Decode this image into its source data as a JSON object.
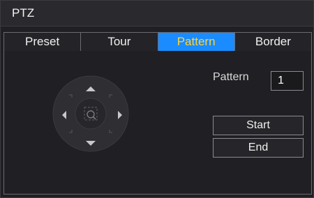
{
  "window": {
    "title": "PTZ"
  },
  "tabs": [
    {
      "label": "Preset",
      "active": false
    },
    {
      "label": "Tour",
      "active": false
    },
    {
      "label": "Pattern",
      "active": true
    },
    {
      "label": "Border",
      "active": false
    }
  ],
  "pattern_panel": {
    "pattern_label": "Pattern",
    "pattern_value": "1",
    "start_label": "Start",
    "end_label": "End"
  },
  "direction_pad": {
    "icons": [
      "arrow-up-icon",
      "arrow-down-icon",
      "arrow-left-icon",
      "arrow-right-icon",
      "zoom-icon"
    ]
  },
  "colors": {
    "accent": "#1a8cff",
    "active_tab_text": "#ffd33a",
    "background": "#202024"
  }
}
